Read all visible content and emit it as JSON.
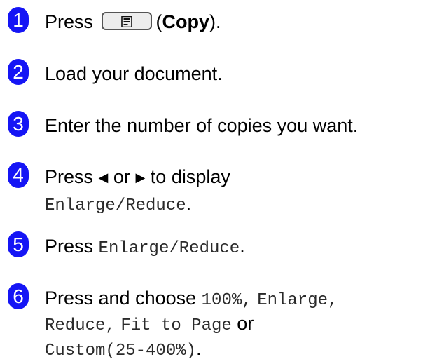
{
  "colors": {
    "step_badge": "#1515f5",
    "text": "#000000"
  },
  "steps": [
    {
      "number": "1",
      "press": "Press",
      "button_icon": "copy-document-icon",
      "open_paren": "(",
      "button_name": "Copy",
      "close_paren": ")."
    },
    {
      "number": "2",
      "text": "Load your document."
    },
    {
      "number": "3",
      "text": "Enter the number of copies you want."
    },
    {
      "number": "4",
      "press": "Press",
      "left_arrow": "◀",
      "or": "or",
      "right_arrow": "▶",
      "to_display": "to display",
      "menu_item": "Enlarge/Reduce",
      "end": "."
    },
    {
      "number": "5",
      "press": "Press",
      "menu_item": "Enlarge/Reduce",
      "end": "."
    },
    {
      "number": "6",
      "press_choose": "Press and choose",
      "opt1": "100%",
      "sep1": ",",
      "opt2": "Enlarge",
      "sep2": ",",
      "opt3": "Reduce",
      "sep3": ",",
      "opt4": "Fit to Page",
      "or": "or",
      "opt5": "Custom(25-400%)",
      "end": "."
    }
  ]
}
